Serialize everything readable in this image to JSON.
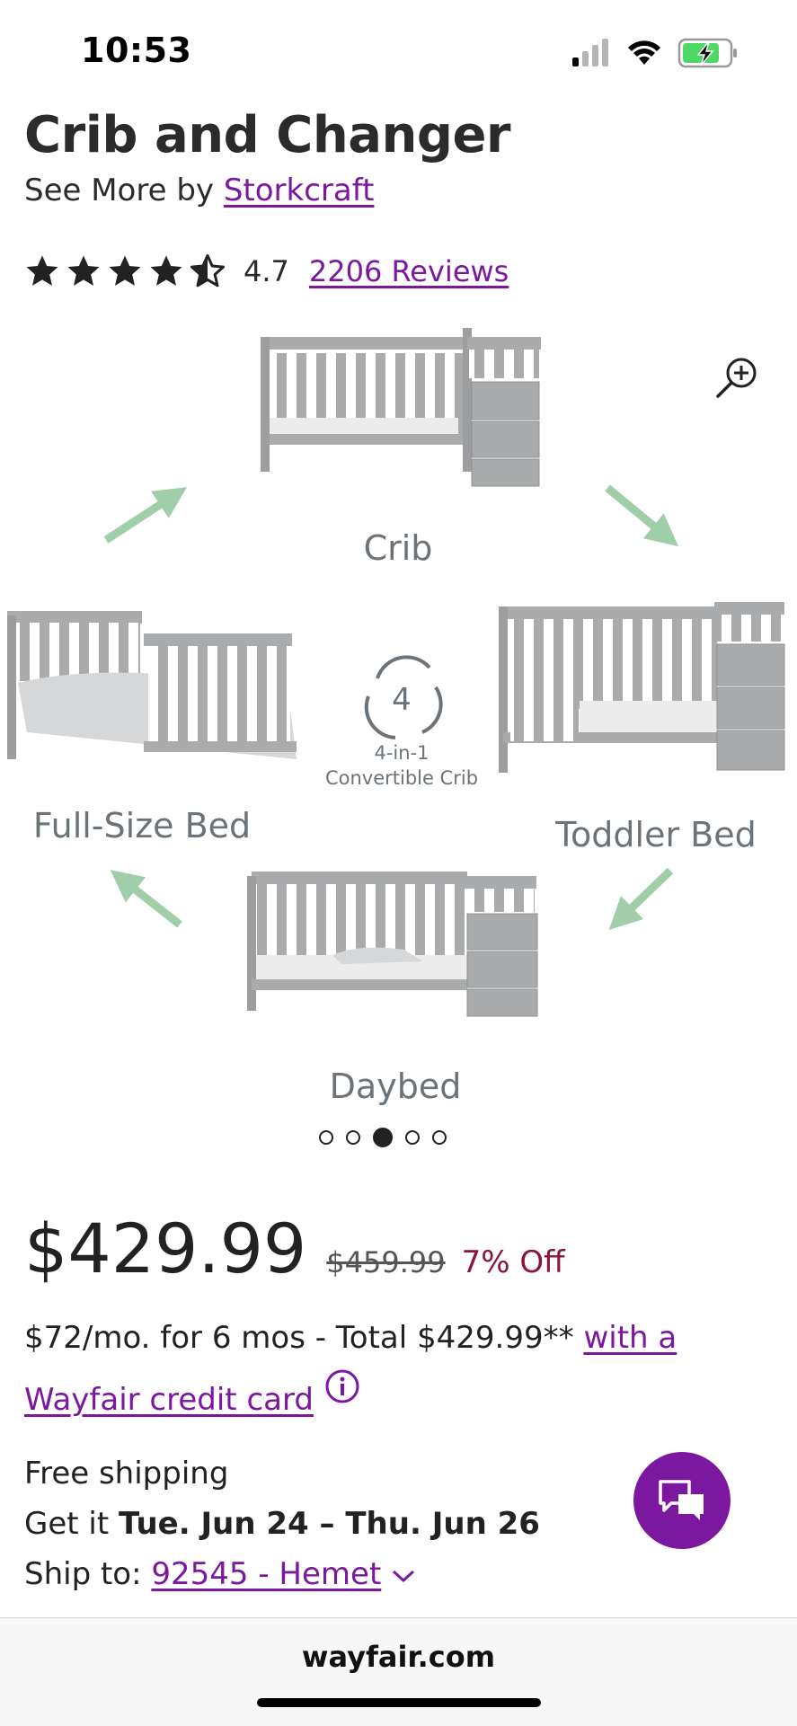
{
  "status": {
    "time": "10:53"
  },
  "product": {
    "title": "Crib and Changer",
    "see_more_prefix": "See More by ",
    "brand": "Storkcraft",
    "rating": "4.7",
    "stars": 4.5,
    "reviews": "2206 Reviews"
  },
  "gallery": {
    "labels": {
      "crib": "Crib",
      "toddler": "Toddler Bed",
      "daybed": "Daybed",
      "fullsize": "Full-Size Bed",
      "center_number": "4",
      "center_line1": "4-in-1",
      "center_line2": "Convertible Crib"
    },
    "dots_count": 5,
    "active_dot": 3
  },
  "pricing": {
    "price": "$429.99",
    "old_price": "$459.99",
    "discount": "7% Off",
    "finance_text": "$72/mo. for 6 mos - Total $429.99** ",
    "finance_link": "with a Wayfair credit card"
  },
  "shipping": {
    "free": "Free shipping",
    "get_it_prefix": "Get it ",
    "dates": "Tue. Jun 24 – Thu. Jun 26",
    "ship_to_prefix": "Ship to: ",
    "location": "92545 - Hemet"
  },
  "browser": {
    "url": "wayfair.com"
  },
  "colors": {
    "accent": "#7b189f",
    "discount": "#8b1538",
    "arrow": "#9fcea8"
  }
}
